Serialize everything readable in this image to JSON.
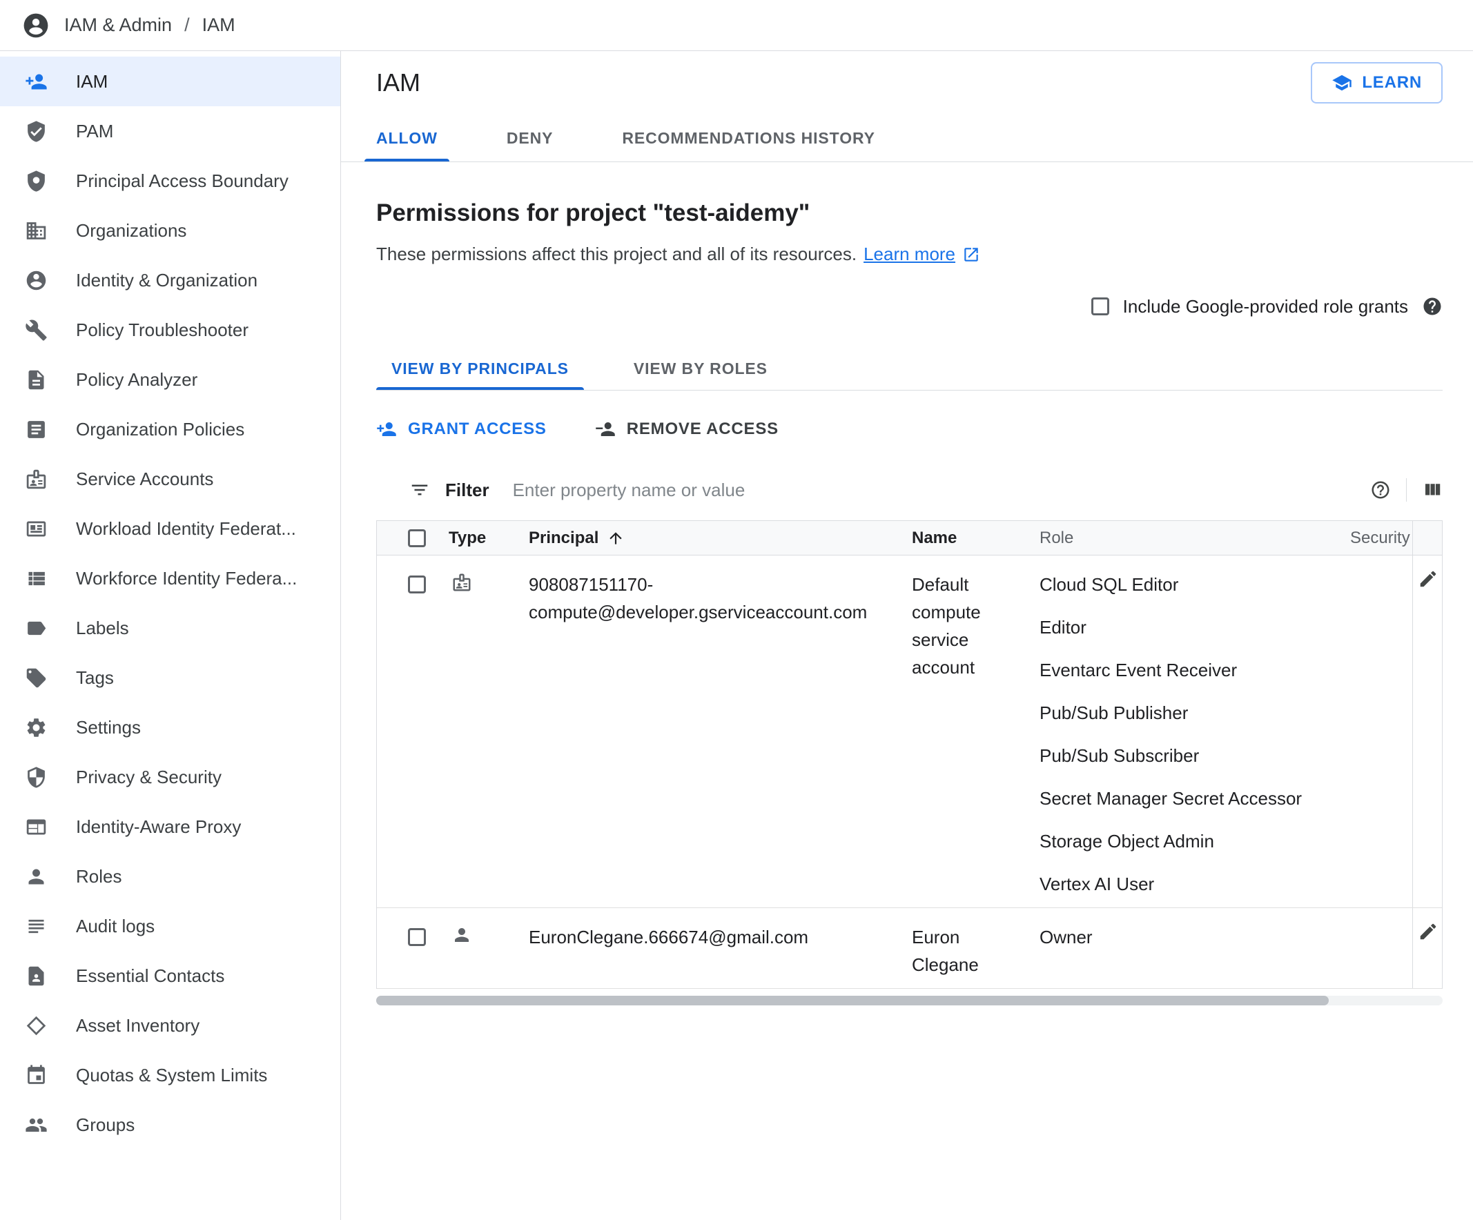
{
  "breadcrumb": {
    "section": "IAM & Admin",
    "separator": "/",
    "page": "IAM"
  },
  "sidebar": {
    "items": [
      {
        "label": "IAM",
        "icon": "person-add-icon",
        "selected": true
      },
      {
        "label": "PAM",
        "icon": "shield-check-icon",
        "selected": false
      },
      {
        "label": "Principal Access Boundary",
        "icon": "boundary-icon",
        "selected": false
      },
      {
        "label": "Organizations",
        "icon": "domain-icon",
        "selected": false
      },
      {
        "label": "Identity & Organization",
        "icon": "account-circle-icon",
        "selected": false
      },
      {
        "label": "Policy Troubleshooter",
        "icon": "wrench-icon",
        "selected": false
      },
      {
        "label": "Policy Analyzer",
        "icon": "document-icon",
        "selected": false
      },
      {
        "label": "Organization Policies",
        "icon": "article-icon",
        "selected": false
      },
      {
        "label": "Service Accounts",
        "icon": "badge-icon",
        "selected": false
      },
      {
        "label": "Workload Identity Federat...",
        "icon": "card-icon",
        "selected": false
      },
      {
        "label": "Workforce Identity Federa...",
        "icon": "list-icon",
        "selected": false
      },
      {
        "label": "Labels",
        "icon": "label-icon",
        "selected": false
      },
      {
        "label": "Tags",
        "icon": "tag-icon",
        "selected": false
      },
      {
        "label": "Settings",
        "icon": "gear-icon",
        "selected": false
      },
      {
        "label": "Privacy & Security",
        "icon": "security-shield-icon",
        "selected": false
      },
      {
        "label": "Identity-Aware Proxy",
        "icon": "window-icon",
        "selected": false
      },
      {
        "label": "Roles",
        "icon": "person-icon",
        "selected": false
      },
      {
        "label": "Audit logs",
        "icon": "lines-icon",
        "selected": false
      },
      {
        "label": "Essential Contacts",
        "icon": "contact-card-icon",
        "selected": false
      },
      {
        "label": "Asset Inventory",
        "icon": "diamond-icon",
        "selected": false
      },
      {
        "label": "Quotas & System Limits",
        "icon": "calendar-icon",
        "selected": false
      },
      {
        "label": "Groups",
        "icon": "groups-icon",
        "selected": false
      }
    ]
  },
  "header": {
    "title": "IAM",
    "learn_button_label": "LEARN"
  },
  "tabs": {
    "items": [
      {
        "label": "ALLOW",
        "active": true
      },
      {
        "label": "DENY",
        "active": false
      },
      {
        "label": "RECOMMENDATIONS HISTORY",
        "active": false
      }
    ]
  },
  "permissions": {
    "heading": "Permissions for project \"test-aidemy\"",
    "description": "These permissions affect this project and all of its resources.",
    "learn_more_label": "Learn more",
    "include_google_roles_label": "Include Google-provided role grants"
  },
  "view_tabs": {
    "items": [
      {
        "label": "VIEW BY PRINCIPALS",
        "active": true
      },
      {
        "label": "VIEW BY ROLES",
        "active": false
      }
    ]
  },
  "actions": {
    "grant_label": "GRANT ACCESS",
    "remove_label": "REMOVE ACCESS"
  },
  "filter": {
    "label": "Filter",
    "placeholder": "Enter property name or value"
  },
  "table": {
    "columns": {
      "type": "Type",
      "principal": "Principal",
      "name": "Name",
      "role": "Role",
      "security": "Security"
    },
    "rows": [
      {
        "type_icon": "service-account-icon",
        "principal": "908087151170-compute@developer.gserviceaccount.com",
        "name": "Default compute service account",
        "roles": [
          "Cloud SQL Editor",
          "Editor",
          "Eventarc Event Receiver",
          "Pub/Sub Publisher",
          "Pub/Sub Subscriber",
          "Secret Manager Secret Accessor",
          "Storage Object Admin",
          "Vertex AI User"
        ]
      },
      {
        "type_icon": "person-icon",
        "principal": "EuronClegane.666674@gmail.com",
        "name": "Euron Clegane",
        "roles": [
          "Owner"
        ]
      }
    ]
  },
  "colors": {
    "accent_blue": "#1a73e8",
    "selected_bg": "#e8f0fe",
    "text_primary": "#202124",
    "text_secondary": "#5f6368",
    "border": "#dadce0"
  }
}
